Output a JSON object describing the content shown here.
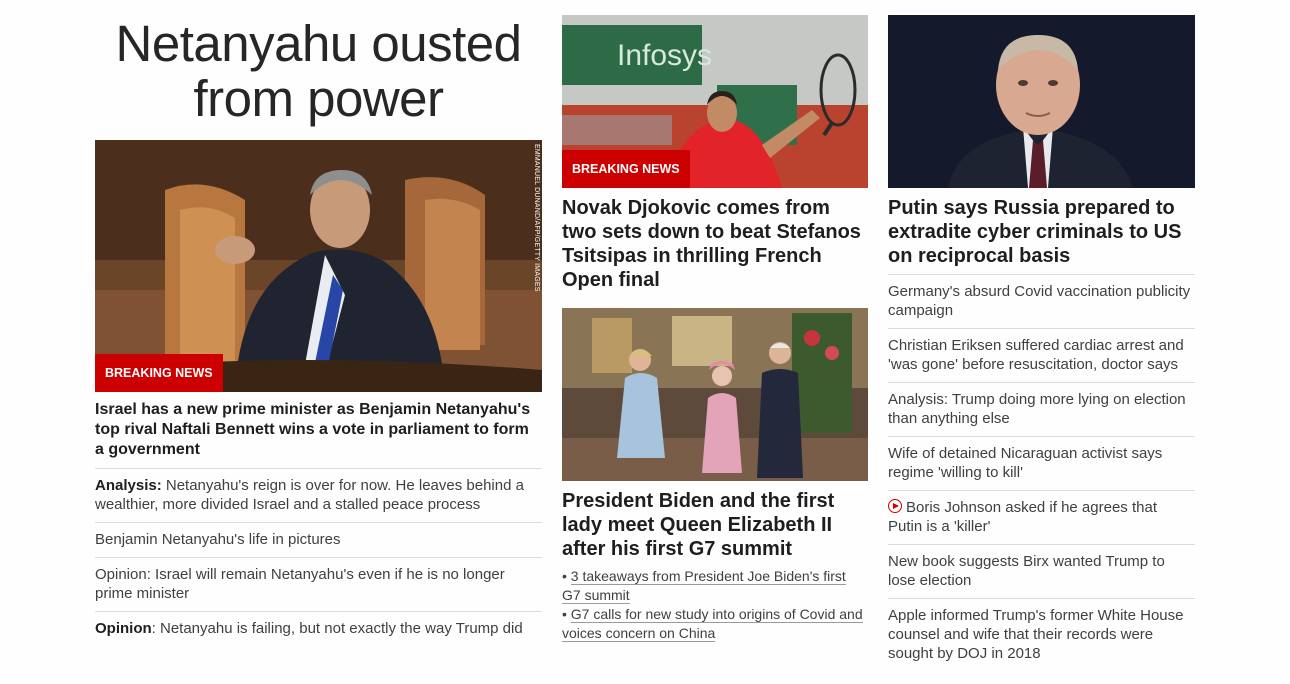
{
  "lead": {
    "headline_line1": "Netanyahu ousted",
    "headline_line2": "from power",
    "badge": "BREAKING NEWS",
    "photo_credit": "EMMANUEL DUNAND/AFP/GETTY IMAGES",
    "summary": "Israel has a new prime minister as Benjamin Netanyahu's top rival Naftali Bennett wins a vote in parliament to form a government",
    "related": [
      {
        "prefix": "Analysis:",
        "text": " Netanyahu's reign is over for now. He leaves behind a wealthier, more divided Israel and a stalled peace process"
      },
      {
        "prefix": "",
        "text": "Benjamin Netanyahu's life in pictures"
      },
      {
        "prefix": "",
        "text": "Opinion: Israel will remain Netanyahu's even if he is no longer prime minister"
      },
      {
        "prefix": "Opinion",
        "text": ": Netanyahu is failing, but not exactly the way Trump did"
      }
    ]
  },
  "middle": {
    "story1": {
      "badge": "BREAKING NEWS",
      "headline": "Novak Djokovic comes from two sets down to beat Stefanos Tsitsipas in thrilling French Open final"
    },
    "story2": {
      "headline": "President Biden and the first lady meet Queen Elizabeth II after his first G7 summit",
      "bullets": [
        "3 takeaways from President Joe Biden's first G7 summit",
        "G7 calls for new study into origins of Covid and voices concern on China"
      ]
    }
  },
  "right": {
    "headline": "Putin says Russia prepared to extradite cyber criminals to US on reciprocal basis",
    "list": [
      {
        "text": "Germany's absurd Covid vaccination publicity campaign",
        "video": false
      },
      {
        "text": "Christian Eriksen suffered cardiac arrest and 'was gone' before resuscitation, doctor says",
        "video": false
      },
      {
        "text": "Analysis: Trump doing more lying on election than anything else",
        "video": false
      },
      {
        "text": "Wife of detained Nicaraguan activist says regime 'willing to kill'",
        "video": false
      },
      {
        "text": "Boris Johnson asked if he agrees that Putin is a 'killer'",
        "video": true,
        "icon": "play-icon"
      },
      {
        "text": "New book suggests Birx wanted Trump to lose election",
        "video": false
      },
      {
        "text": "Apple informed Trump's former White House counsel and wife that their records were sought by DOJ in 2018",
        "video": false
      }
    ]
  },
  "colors": {
    "accent_red": "#cc0000",
    "text": "#262626",
    "divider": "#dcdcdc"
  }
}
